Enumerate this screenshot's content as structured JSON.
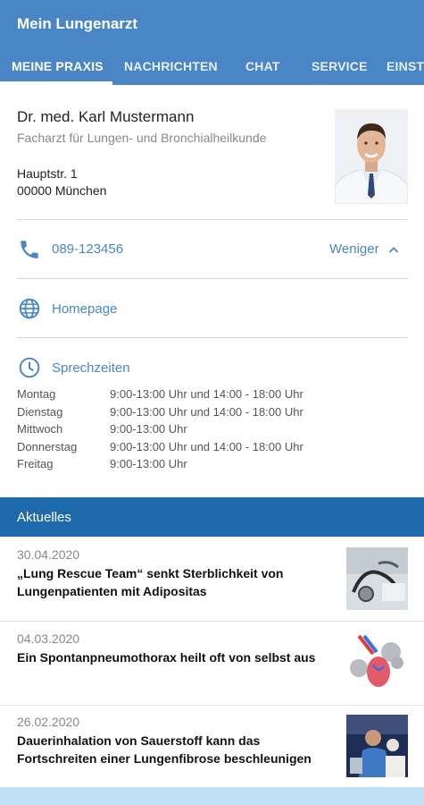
{
  "app": {
    "title": "Mein Lungenarzt"
  },
  "tabs": [
    {
      "label": "MEINE PRAXIS",
      "active": true
    },
    {
      "label": "NACHRICHTEN",
      "active": false
    },
    {
      "label": "CHAT",
      "active": false
    },
    {
      "label": "SERVICE",
      "active": false
    },
    {
      "label": "EINST",
      "active": false
    }
  ],
  "doctor": {
    "name": "Dr. med. Karl Mustermann",
    "specialty": "Facharzt für Lungen- und Bronchialheilkunde",
    "street": "Hauptstr. 1",
    "city": "00000 München",
    "photo_icon": "doctor-portrait"
  },
  "contact": {
    "phone": "089-123456",
    "phone_icon": "phone-icon",
    "toggle_label": "Weniger",
    "toggle_icon": "chevron-up-icon",
    "homepage": "Homepage",
    "homepage_icon": "globe-icon"
  },
  "hours": {
    "title": "Sprechzeiten",
    "icon": "clock-icon",
    "rows": [
      {
        "day": "Montag",
        "time": "9:00-13:00 Uhr und 14:00 - 18:00 Uhr"
      },
      {
        "day": "Dienstag",
        "time": "9:00-13:00 Uhr und 14:00 - 18:00 Uhr"
      },
      {
        "day": "Mittwoch",
        "time": "9:00-13:00 Uhr"
      },
      {
        "day": "Donnerstag",
        "time": "9:00-13:00 Uhr und 14:00 - 18:00 Uhr"
      },
      {
        "day": "Freitag",
        "time": "9:00-13:00 Uhr"
      }
    ]
  },
  "news": {
    "header": "Aktuelles",
    "items": [
      {
        "date": "30.04.2020",
        "title": "„Lung Rescue Team“ senkt Sterblichkeit von Lungenpatienten mit Adipositas",
        "thumb": "stethoscope-image"
      },
      {
        "date": "04.03.2020",
        "title": "Ein Spontanpneumothorax heilt oft von selbst aus",
        "thumb": "lung-illustration"
      },
      {
        "date": "26.02.2020",
        "title": "Dauerinhalation von Sauerstoff kann das Fortschreiten einer Lungenfibrose beschleunigen",
        "thumb": "clinic-photo"
      }
    ]
  },
  "colors": {
    "primary": "#4a86c5",
    "header_dark": "#1f6aad",
    "bottom_bar": "#bfe0f6"
  }
}
